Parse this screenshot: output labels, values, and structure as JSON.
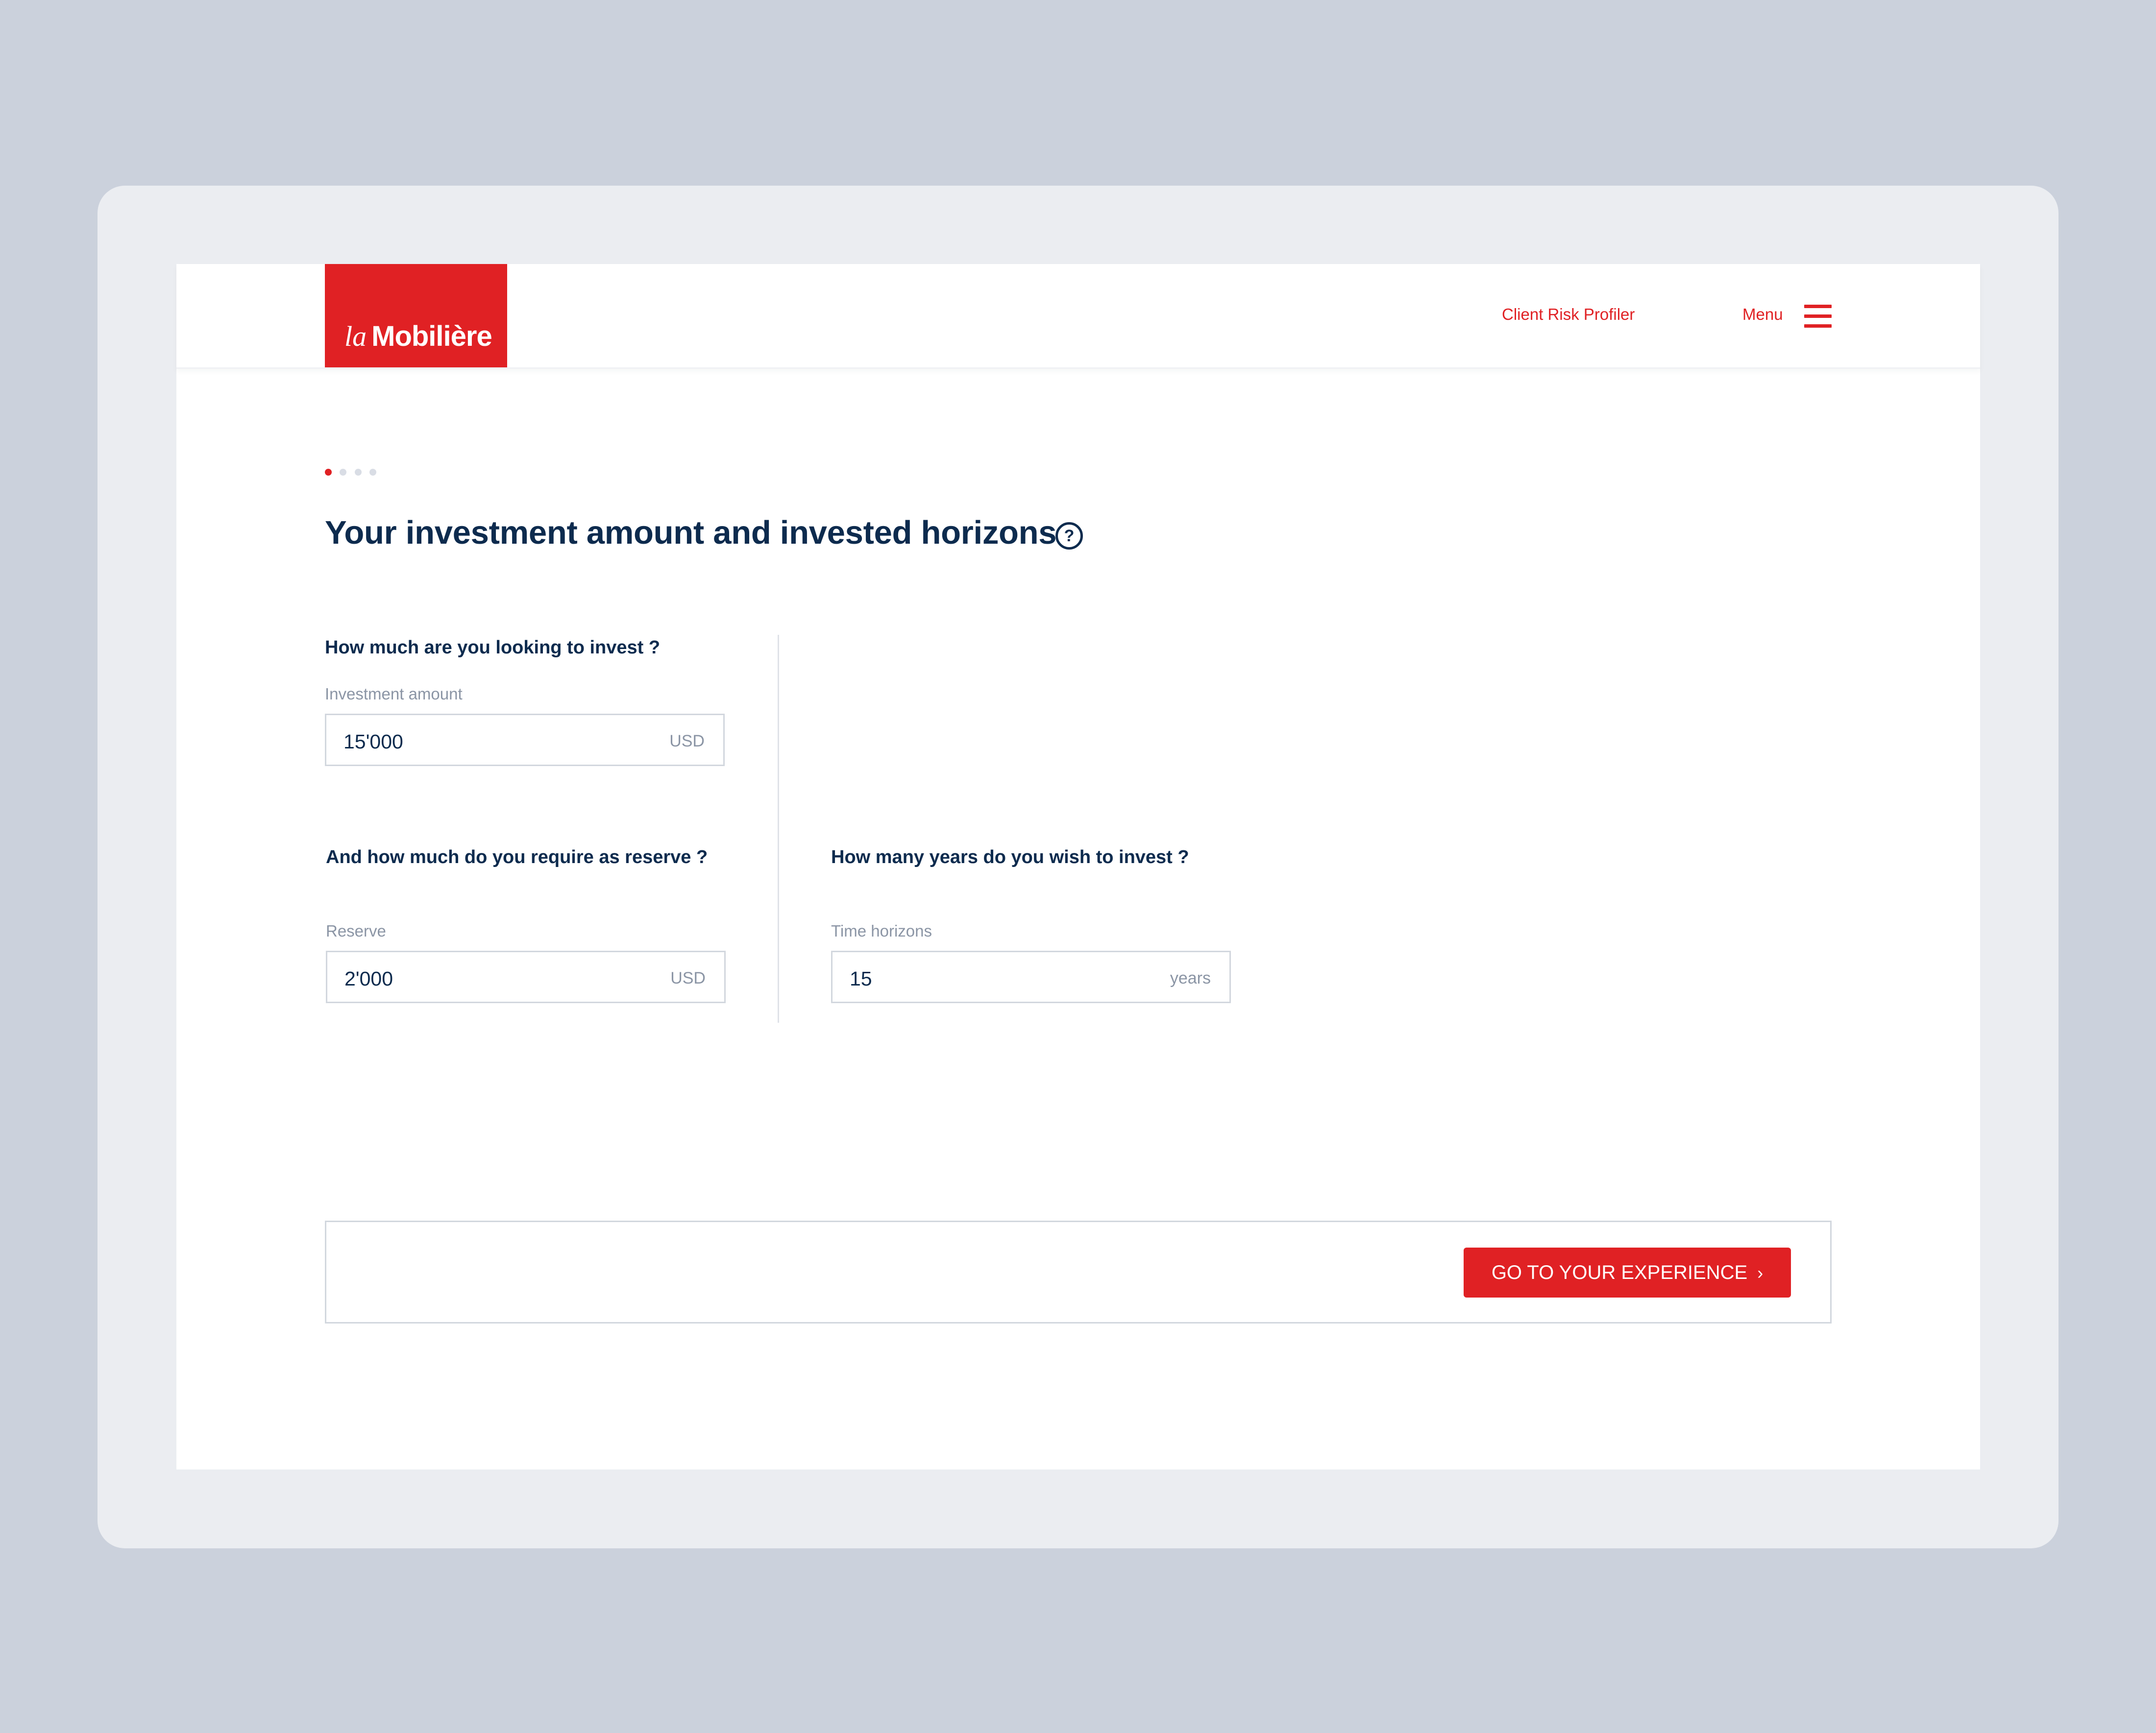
{
  "brand": {
    "logo_prefix": "la",
    "logo_name": "Mobilière",
    "accent_color": "#e02124",
    "text_color": "#0d2b4e"
  },
  "header": {
    "nav_link": "Client Risk Profiler",
    "menu_label": "Menu",
    "menu_icon": "hamburger-icon"
  },
  "progress": {
    "total_steps": 4,
    "current_step": 1
  },
  "page": {
    "title": "Your investment amount and invested horizons",
    "help_icon": "question-circle-icon",
    "help_glyph": "?"
  },
  "investment": {
    "question": "How much are you looking to invest ?",
    "label": "Investment amount",
    "value": "15'000",
    "unit": "USD"
  },
  "reserve": {
    "question": "And how much do you require as reserve ?",
    "label": "Reserve",
    "value": "2'000",
    "unit": "USD"
  },
  "horizon": {
    "question": "How many years do you wish to invest ?",
    "label": "Time horizons",
    "value": "15",
    "unit": "years"
  },
  "footer": {
    "cta_label": "GO TO YOUR EXPERIENCE",
    "cta_icon": "chevron-right-icon",
    "cta_glyph": "›"
  }
}
